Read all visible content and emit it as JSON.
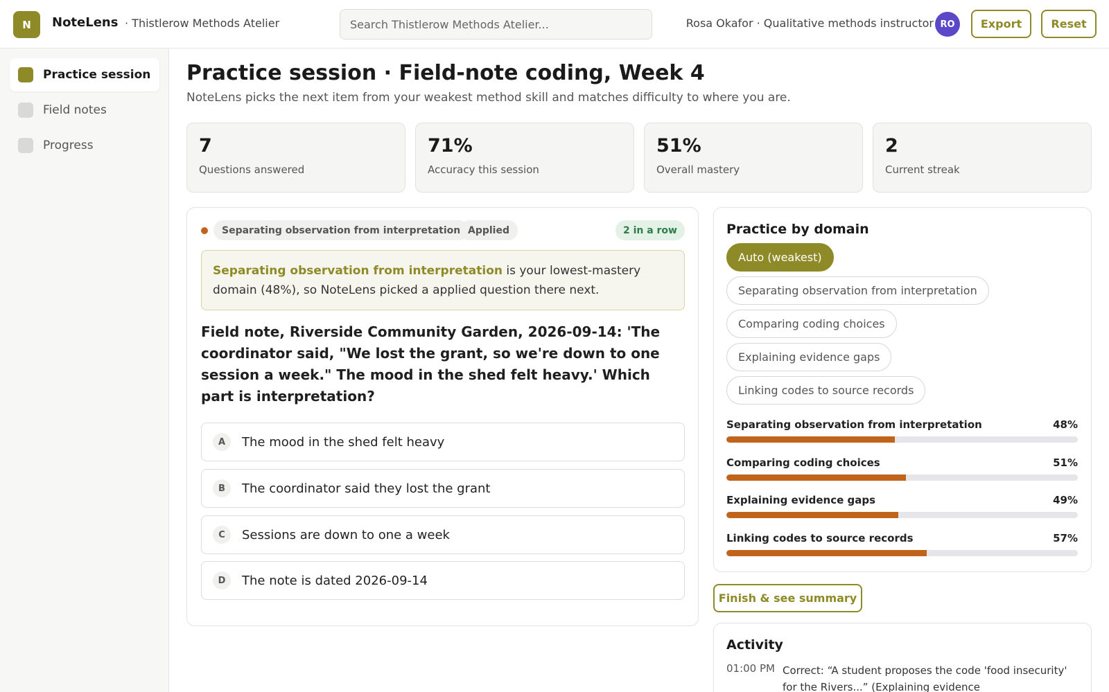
{
  "header": {
    "logo_letter": "N",
    "app_name": "NoteLens",
    "workspace": "· Thistlerow Methods Atelier",
    "search_placeholder": "Search Thistlerow Methods Atelier...",
    "user": "Rosa Okafor · Qualitative methods instructor",
    "avatar_initials": "RO",
    "export_label": "Export",
    "reset_label": "Reset"
  },
  "sidebar": {
    "items": [
      {
        "label": "Practice session",
        "active": true
      },
      {
        "label": "Field notes",
        "active": false
      },
      {
        "label": "Progress",
        "active": false
      }
    ]
  },
  "main": {
    "title": "Practice session · Field-note coding, Week 4",
    "subtitle": "NoteLens picks the next item from your weakest method skill and matches difficulty to where you are.",
    "stats": [
      {
        "value": "7",
        "label": "Questions answered"
      },
      {
        "value": "71%",
        "label": "Accuracy this session"
      },
      {
        "value": "51%",
        "label": "Overall mastery"
      },
      {
        "value": "2",
        "label": "Current streak"
      }
    ]
  },
  "question": {
    "domain_chip": "Separating observation from interpretation",
    "level_chip": "Applied",
    "streak_badge": "2 in a row",
    "explain_highlight": "Separating observation from interpretation",
    "explain_rest": " is your lowest-mastery domain (48%), so NoteLens picked a applied question there next.",
    "text": "Field note, Riverside Community Garden, 2026-09-14: 'The coordinator said, \"We lost the grant, so we're down to one session a week.\" The mood in the shed felt heavy.' Which part is interpretation?",
    "options": [
      {
        "letter": "A",
        "text": "The mood in the shed felt heavy"
      },
      {
        "letter": "B",
        "text": "The coordinator said they lost the grant"
      },
      {
        "letter": "C",
        "text": "Sessions are down to one a week"
      },
      {
        "letter": "D",
        "text": "The note is dated 2026-09-14"
      }
    ]
  },
  "domains": {
    "title": "Practice by domain",
    "chips": [
      {
        "label": "Auto (weakest)",
        "active": true
      },
      {
        "label": "Separating observation from interpretation",
        "active": false
      },
      {
        "label": "Comparing coding choices",
        "active": false
      },
      {
        "label": "Explaining evidence gaps",
        "active": false
      },
      {
        "label": "Linking codes to source records",
        "active": false
      }
    ],
    "mastery": [
      {
        "name": "Separating observation from interpretation",
        "pct_label": "48%",
        "value": 48
      },
      {
        "name": "Comparing coding choices",
        "pct_label": "51%",
        "value": 51
      },
      {
        "name": "Explaining evidence gaps",
        "pct_label": "49%",
        "value": 49
      },
      {
        "name": "Linking codes to source records",
        "pct_label": "57%",
        "value": 57
      }
    ],
    "bar_color": "#c0641c"
  },
  "finish_label": "Finish & see summary",
  "activity": {
    "title": "Activity",
    "entries": [
      {
        "time": "01:00 PM",
        "text": "Correct: “A student proposes the code 'food insecurity' for the Rivers...” (Explaining evidence"
      }
    ]
  },
  "colors": {
    "accent": "#8e8a27",
    "mastery_bar": "#c0641c",
    "streak_green": "#2e7d4a"
  }
}
